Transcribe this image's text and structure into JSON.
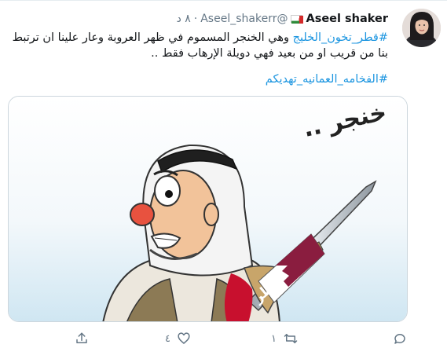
{
  "tweet": {
    "display_name": "Aseel shaker",
    "handle": "@Aseel_shakerr",
    "dot": "·",
    "time": "٨ د",
    "text_hashtag": "#قطر_تخون_الخليج",
    "text_line1": " وهي الخنجر المسموم في ظهر العروبة وعار علينا ان ترتبط",
    "text_line2": "بنا من قريب او من بعيد فهي دويلة الإرهاب فقط ..",
    "hashtag2": "#الفخامه_العمانيه_تهديكم"
  },
  "media": {
    "cartoon_caption": "خنجر ..",
    "dagger_label": "قطر"
  },
  "actions": {
    "reply_count": "٤",
    "retweet_count": "١"
  },
  "icons": {
    "share": "share-icon",
    "like": "heart-icon",
    "retweet": "retweet-icon",
    "reply": "reply-icon",
    "flag": "oman-flag-icon"
  },
  "colors": {
    "link": "#1b95e0",
    "muted": "#657786",
    "text": "#14171a"
  }
}
